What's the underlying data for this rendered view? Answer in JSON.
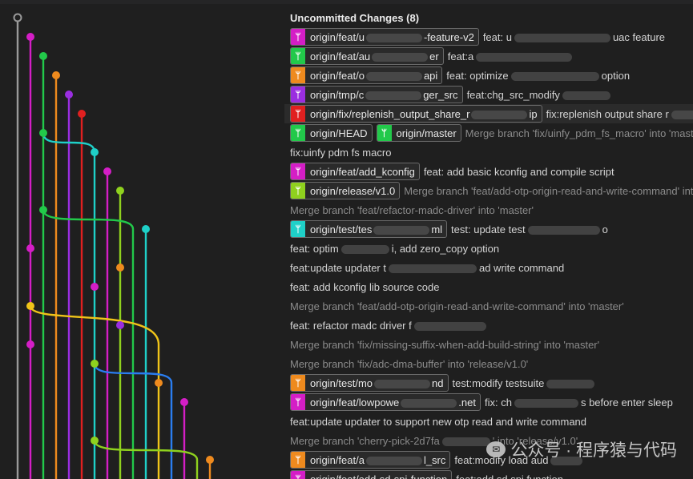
{
  "header": {
    "title": "Uncommitted Changes (8)"
  },
  "rows": [
    {
      "tags": [
        {
          "label": "origin/feat/u",
          "label2": "-feature-v2",
          "color": "#d41ec6"
        }
      ],
      "msg": "feat: u",
      "msg2": "uac feature"
    },
    {
      "tags": [
        {
          "label": "origin/feat/au",
          "label2": "er",
          "color": "#22c94a"
        }
      ],
      "msg": "feat:a",
      "msg2": ""
    },
    {
      "tags": [
        {
          "label": "origin/feat/o",
          "label2": "api",
          "color": "#ee8a1e"
        }
      ],
      "msg": "feat: optimize",
      "msg2": "option"
    },
    {
      "tags": [
        {
          "label": "origin/tmp/c",
          "label2": "ger_src",
          "color": "#9a2ee0"
        }
      ],
      "msg": "feat:chg_src_modify",
      "msg2": ""
    },
    {
      "tags": [
        {
          "label": "origin/fix/replenish_output_share_r",
          "label2": "ip",
          "color": "#e02020"
        }
      ],
      "msg": "fix:replenish output share r",
      "msg2": ""
    },
    {
      "tags": [
        {
          "label": "origin/HEAD",
          "label2": "",
          "color": "#22c94a"
        },
        {
          "label": "origin/master",
          "label2": "",
          "color": "#22c94a"
        }
      ],
      "msg": "Merge branch 'fix/uinfy_pdm_fs_macro' into 'master'",
      "msg2": ""
    },
    {
      "tags": [],
      "msg": "fix:uinfy pdm fs macro",
      "msg2": ""
    },
    {
      "tags": [
        {
          "label": "origin/feat/add_kconfig",
          "label2": "",
          "color": "#d41ec6"
        }
      ],
      "msg": "feat: add basic kconfig and compile script",
      "msg2": ""
    },
    {
      "tags": [
        {
          "label": "origin/release/v1.0",
          "label2": "",
          "color": "#8fd11e"
        }
      ],
      "msg": "Merge branch 'feat/add-otp-origin-read-and-write-command' into",
      "msg2": ""
    },
    {
      "tags": [],
      "msg": "Merge branch 'feat/refactor-madc-driver' into 'master'",
      "msg2": ""
    },
    {
      "tags": [
        {
          "label": "origin/test/tes",
          "label2": "ml",
          "color": "#1fd0c8"
        }
      ],
      "msg": "test: update test",
      "msg2": "o"
    },
    {
      "tags": [],
      "msg": "feat: optim",
      "msg2": "i, add zero_copy option"
    },
    {
      "tags": [],
      "msg": "feat:update updater t",
      "msg2": "ad write command"
    },
    {
      "tags": [],
      "msg": "feat: add kconfig lib source code",
      "msg2": ""
    },
    {
      "tags": [],
      "msg": "Merge branch 'feat/add-otp-origin-read-and-write-command' into 'master'",
      "msg2": ""
    },
    {
      "tags": [],
      "msg": "feat: refactor madc driver f",
      "msg2": ""
    },
    {
      "tags": [],
      "msg": "Merge branch 'fix/missing-suffix-when-add-build-string' into 'master'",
      "msg2": ""
    },
    {
      "tags": [],
      "msg": "Merge branch 'fix/adc-dma-buffer' into 'release/v1.0'",
      "msg2": ""
    },
    {
      "tags": [
        {
          "label": "origin/test/mo",
          "label2": "nd",
          "color": "#ee8a1e"
        }
      ],
      "msg": "test:modify testsuite",
      "msg2": ""
    },
    {
      "tags": [
        {
          "label": "origin/feat/lowpowe",
          "label2": ".net",
          "color": "#d41ec6"
        }
      ],
      "msg": "fix: ch",
      "msg2": "s before enter sleep"
    },
    {
      "tags": [],
      "msg": "feat:update updater to support new otp read and write command",
      "msg2": ""
    },
    {
      "tags": [],
      "msg": "Merge branch 'cherry-pick-2d7fa",
      "msg2": "' into 'release/v1.0'"
    },
    {
      "tags": [
        {
          "label": "origin/feat/a",
          "label2": "l_src",
          "color": "#ee8a1e"
        }
      ],
      "msg": "feat:modify load aud",
      "msg2": ""
    },
    {
      "tags": [
        {
          "label": "origin/feat/add-sd-spi-function",
          "label2": "",
          "color": "#d41ec6"
        }
      ],
      "msg": "feat:add sd spi function",
      "msg2": ""
    }
  ],
  "watermark": {
    "logo": "✉",
    "text": "公众号 · 程序猿与代码"
  }
}
